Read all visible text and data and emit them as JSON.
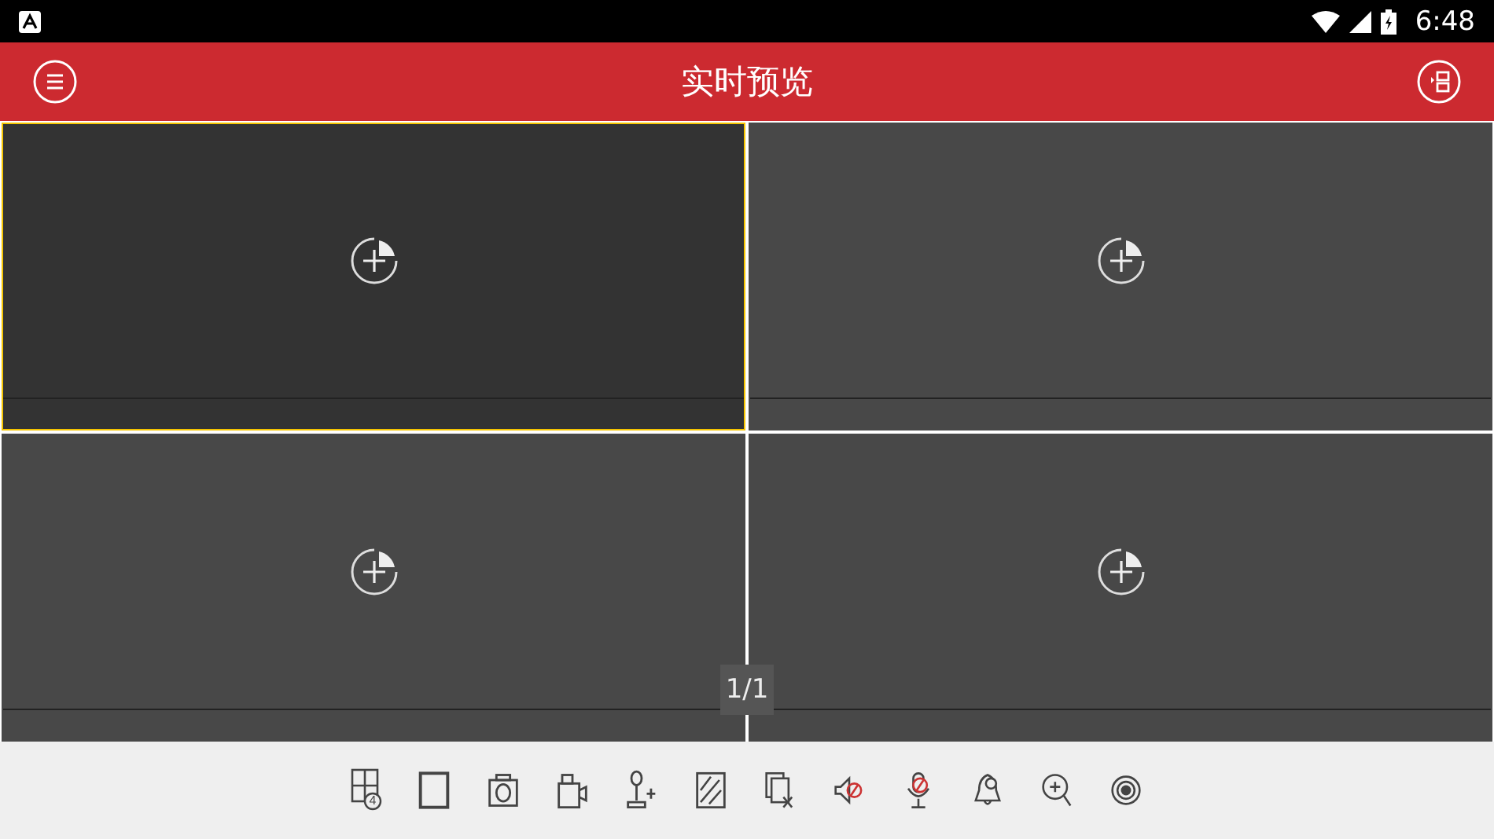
{
  "status_bar": {
    "time": "6:48"
  },
  "header": {
    "title": "实时预览"
  },
  "panes": [
    {
      "selected": true
    },
    {
      "selected": false
    },
    {
      "selected": false
    },
    {
      "selected": false
    }
  ],
  "page_indicator": "1/1",
  "toolbar": {
    "layout_count": "4"
  }
}
